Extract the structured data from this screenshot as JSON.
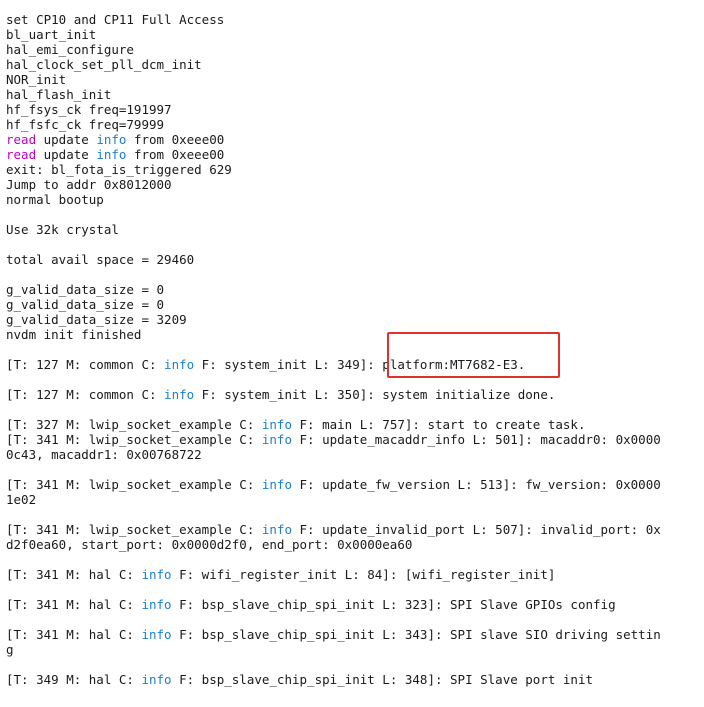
{
  "colors": {
    "read_keyword": "#c000c0",
    "info_keyword": "#1a7fd0",
    "highlight_border": "#e03030",
    "text": "#1a1a1a",
    "background": "#ffffff"
  },
  "lines": [
    [
      {
        "t": "set CP10 and CP11 Full Access"
      }
    ],
    [
      {
        "t": "bl_uart_init"
      }
    ],
    [
      {
        "t": "hal_emi_configure"
      }
    ],
    [
      {
        "t": "hal_clock_set_pll_dcm_init"
      }
    ],
    [
      {
        "t": "NOR_init"
      }
    ],
    [
      {
        "t": "hal_flash_init"
      }
    ],
    [
      {
        "t": "hf_fsys_ck freq=191997"
      }
    ],
    [
      {
        "t": "hf_fsfc_ck freq=79999"
      }
    ],
    [
      {
        "t": "read",
        "c": "read"
      },
      {
        "t": " update "
      },
      {
        "t": "info",
        "c": "info"
      },
      {
        "t": " from 0xeee00"
      }
    ],
    [
      {
        "t": "read",
        "c": "read"
      },
      {
        "t": " update "
      },
      {
        "t": "info",
        "c": "info"
      },
      {
        "t": " from 0xeee00"
      }
    ],
    [
      {
        "t": "exit: bl_fota_is_triggered 629"
      }
    ],
    [
      {
        "t": "Jump to addr 0x8012000"
      }
    ],
    [
      {
        "t": "normal bootup"
      }
    ],
    [],
    [
      {
        "t": "Use 32k crystal"
      }
    ],
    [],
    [
      {
        "t": "total avail space = 29460"
      }
    ],
    [],
    [
      {
        "t": "g_valid_data_size = 0"
      }
    ],
    [
      {
        "t": "g_valid_data_size = 0"
      }
    ],
    [
      {
        "t": "g_valid_data_size = 3209"
      }
    ],
    [
      {
        "t": "nvdm init finished"
      }
    ],
    [],
    [
      {
        "t": "[T: 127 M: common C: "
      },
      {
        "t": "info",
        "c": "info"
      },
      {
        "t": " F: system_init L: 349]: platform:MT7682-E3."
      }
    ],
    [],
    [
      {
        "t": "[T: 127 M: common C: "
      },
      {
        "t": "info",
        "c": "info"
      },
      {
        "t": " F: system_init L: 350]: system initialize done."
      }
    ],
    [],
    [
      {
        "t": "[T: 327 M: lwip_socket_example C: "
      },
      {
        "t": "info",
        "c": "info"
      },
      {
        "t": " F: main L: 757]: start to create task."
      }
    ],
    [
      {
        "t": "[T: 341 M: lwip_socket_example C: "
      },
      {
        "t": "info",
        "c": "info"
      },
      {
        "t": " F: update_macaddr_info L: 501]: macaddr0: 0x0000"
      }
    ],
    [
      {
        "t": "0c43, macaddr1: 0x00768722"
      }
    ],
    [],
    [
      {
        "t": "[T: 341 M: lwip_socket_example C: "
      },
      {
        "t": "info",
        "c": "info"
      },
      {
        "t": " F: update_fw_version L: 513]: fw_version: 0x0000"
      }
    ],
    [
      {
        "t": "1e02"
      }
    ],
    [],
    [
      {
        "t": "[T: 341 M: lwip_socket_example C: "
      },
      {
        "t": "info",
        "c": "info"
      },
      {
        "t": " F: update_invalid_port L: 507]: invalid_port: 0x"
      }
    ],
    [
      {
        "t": "d2f0ea60, start_port: 0x0000d2f0, end_port: 0x0000ea60"
      }
    ],
    [],
    [
      {
        "t": "[T: 341 M: hal C: "
      },
      {
        "t": "info",
        "c": "info"
      },
      {
        "t": " F: wifi_register_init L: 84]: [wifi_register_init]"
      }
    ],
    [],
    [
      {
        "t": "[T: 341 M: hal C: "
      },
      {
        "t": "info",
        "c": "info"
      },
      {
        "t": " F: bsp_slave_chip_spi_init L: 323]: SPI Slave GPIOs config"
      }
    ],
    [],
    [
      {
        "t": "[T: 341 M: hal C: "
      },
      {
        "t": "info",
        "c": "info"
      },
      {
        "t": " F: bsp_slave_chip_spi_init L: 343]: SPI slave SIO driving settin"
      }
    ],
    [
      {
        "t": "g"
      }
    ],
    [],
    [
      {
        "t": "[T: 349 M: hal C: "
      },
      {
        "t": "info",
        "c": "info"
      },
      {
        "t": " F: bsp_slave_chip_spi_init L: 348]: SPI Slave port init"
      }
    ]
  ]
}
